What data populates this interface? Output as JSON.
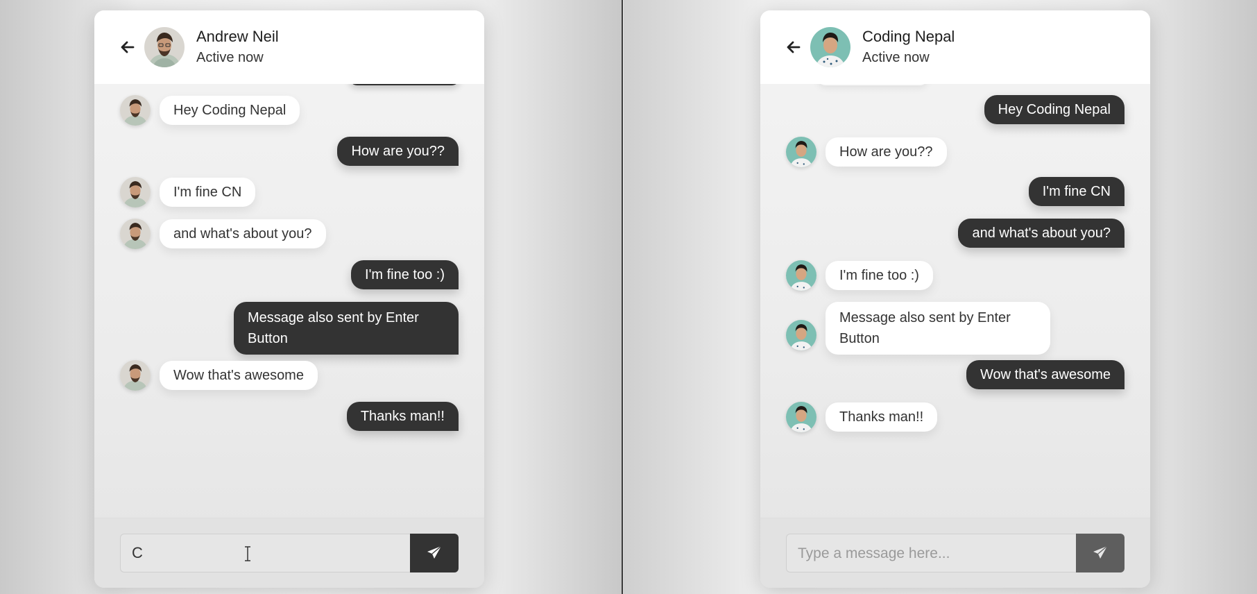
{
  "left_chat": {
    "contact_name": "Andrew Neil",
    "contact_status": "Active now",
    "input_value": "C",
    "input_placeholder": "Type a message here...",
    "messages": [
      {
        "text": "Hey Coding Nepal",
        "direction": "incoming"
      },
      {
        "text": "How are you??",
        "direction": "outgoing"
      },
      {
        "text": "I'm fine CN",
        "direction": "incoming"
      },
      {
        "text": "and what's about you?",
        "direction": "incoming"
      },
      {
        "text": "I'm fine too :)",
        "direction": "outgoing"
      },
      {
        "text": "Message also sent by Enter Button",
        "direction": "outgoing"
      },
      {
        "text": "Wow that's awesome",
        "direction": "incoming"
      },
      {
        "text": "Thanks man!!",
        "direction": "outgoing"
      }
    ]
  },
  "right_chat": {
    "contact_name": "Coding Nepal",
    "contact_status": "Active now",
    "input_value": "",
    "input_placeholder": "Type a message here...",
    "messages": [
      {
        "text": "Hey Coding Nepal",
        "direction": "outgoing"
      },
      {
        "text": "How are you??",
        "direction": "incoming"
      },
      {
        "text": "I'm fine CN",
        "direction": "outgoing"
      },
      {
        "text": "and what's about you?",
        "direction": "outgoing"
      },
      {
        "text": "I'm fine too :)",
        "direction": "incoming"
      },
      {
        "text": "Message also sent by Enter Button",
        "direction": "incoming"
      },
      {
        "text": "Wow that's awesome",
        "direction": "outgoing"
      },
      {
        "text": "Thanks man!!",
        "direction": "incoming"
      }
    ]
  },
  "icons": {
    "back": "arrow-left-icon",
    "send": "paper-plane-icon",
    "avatar": "user-avatar"
  },
  "colors": {
    "outgoing_bubble": "#333333",
    "incoming_bubble": "#ffffff",
    "send_button": "#333333",
    "send_button_disabled": "#5e5e5e"
  }
}
